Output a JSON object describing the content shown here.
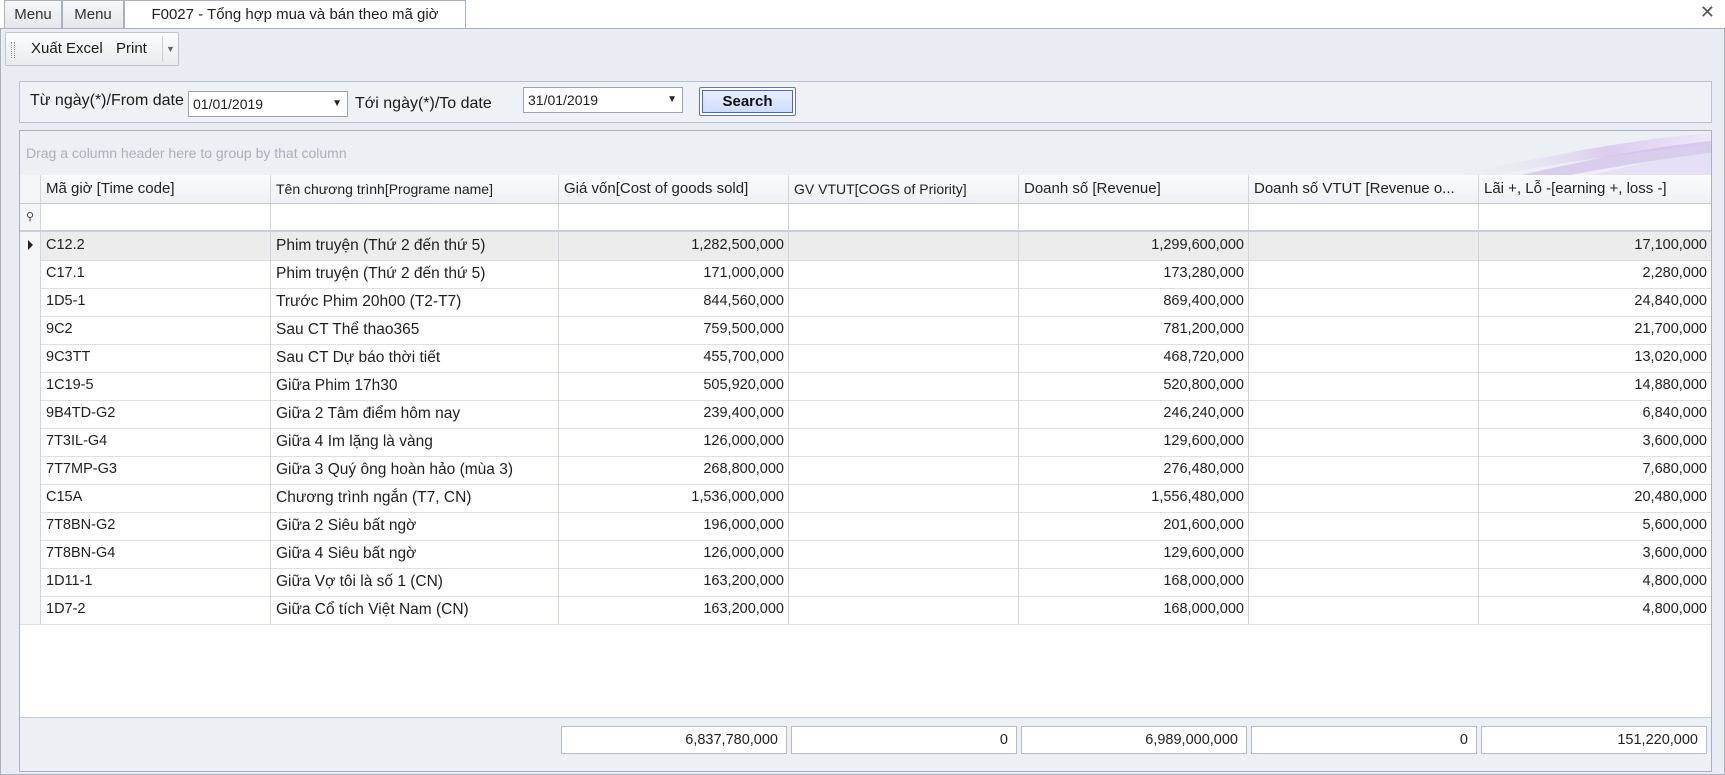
{
  "tabs": [
    {
      "label": "Menu"
    },
    {
      "label": "Menu"
    },
    {
      "label": "F0027 - Tổng hợp mua và bán theo mã giờ"
    }
  ],
  "toolbar": {
    "export_label": "Xuất Excel",
    "print_label": "Print"
  },
  "filter": {
    "from_label": "Từ ngày(*)/From date",
    "from_value": "01/01/2019",
    "to_label": "Tới ngày(*)/To date",
    "to_value": "31/01/2019",
    "search_label": "Search"
  },
  "grid": {
    "group_hint": "Drag a column header here to group by that column",
    "columns": [
      "Mã giờ [Time code]",
      "Tên chương trình[Programe name]",
      "Giá vốn[Cost of goods sold]",
      "GV VTUT[COGS of Priority]",
      "Doanh số [Revenue]",
      "Doanh số VTUT [Revenue o...",
      "Lãi +, Lỗ -[earning +, loss -]"
    ],
    "rows": [
      {
        "code": "C12.2",
        "name": "Phim truyện (Thứ 2 đến thứ 5)",
        "cogs": "1,282,500,000",
        "cogs_p": "",
        "revenue": "1,299,600,000",
        "revenue_p": "",
        "profit": "17,100,000"
      },
      {
        "code": "C17.1",
        "name": "Phim truyện (Thứ 2 đến thứ 5)",
        "cogs": "171,000,000",
        "cogs_p": "",
        "revenue": "173,280,000",
        "revenue_p": "",
        "profit": "2,280,000"
      },
      {
        "code": "1D5-1",
        "name": "Trước Phim 20h00 (T2-T7)",
        "cogs": "844,560,000",
        "cogs_p": "",
        "revenue": "869,400,000",
        "revenue_p": "",
        "profit": "24,840,000"
      },
      {
        "code": "9C2",
        "name": "Sau CT Thể thao365",
        "cogs": "759,500,000",
        "cogs_p": "",
        "revenue": "781,200,000",
        "revenue_p": "",
        "profit": "21,700,000"
      },
      {
        "code": "9C3TT",
        "name": "Sau CT Dự báo thời tiết",
        "cogs": "455,700,000",
        "cogs_p": "",
        "revenue": "468,720,000",
        "revenue_p": "",
        "profit": "13,020,000"
      },
      {
        "code": "1C19-5",
        "name": "Giữa Phim 17h30",
        "cogs": "505,920,000",
        "cogs_p": "",
        "revenue": "520,800,000",
        "revenue_p": "",
        "profit": "14,880,000"
      },
      {
        "code": "9B4TD-G2",
        "name": "Giữa 2 Tâm điểm hôm nay",
        "cogs": "239,400,000",
        "cogs_p": "",
        "revenue": "246,240,000",
        "revenue_p": "",
        "profit": "6,840,000"
      },
      {
        "code": "7T3IL-G4",
        "name": "Giữa 4 Im lặng là vàng",
        "cogs": "126,000,000",
        "cogs_p": "",
        "revenue": "129,600,000",
        "revenue_p": "",
        "profit": "3,600,000"
      },
      {
        "code": "7T7MP-G3",
        "name": "Giữa 3 Quý ông hoàn hảo (mùa 3)",
        "cogs": "268,800,000",
        "cogs_p": "",
        "revenue": "276,480,000",
        "revenue_p": "",
        "profit": "7,680,000"
      },
      {
        "code": "C15A",
        "name": "Chương trình ngắn (T7, CN)",
        "cogs": "1,536,000,000",
        "cogs_p": "",
        "revenue": "1,556,480,000",
        "revenue_p": "",
        "profit": "20,480,000"
      },
      {
        "code": "7T8BN-G2",
        "name": "Giữa 2 Siêu bất ngờ",
        "cogs": "196,000,000",
        "cogs_p": "",
        "revenue": "201,600,000",
        "revenue_p": "",
        "profit": "5,600,000"
      },
      {
        "code": "7T8BN-G4",
        "name": "Giữa 4 Siêu bất ngờ",
        "cogs": "126,000,000",
        "cogs_p": "",
        "revenue": "129,600,000",
        "revenue_p": "",
        "profit": "3,600,000"
      },
      {
        "code": "1D11-1",
        "name": "Giữa Vợ tôi là số 1 (CN)",
        "cogs": "163,200,000",
        "cogs_p": "",
        "revenue": "168,000,000",
        "revenue_p": "",
        "profit": "4,800,000"
      },
      {
        "code": "1D7-2",
        "name": "Giữa Cổ tích Việt Nam (CN)",
        "cogs": "163,200,000",
        "cogs_p": "",
        "revenue": "168,000,000",
        "revenue_p": "",
        "profit": "4,800,000"
      }
    ],
    "totals": {
      "cogs": "6,837,780,000",
      "cogs_p": "0",
      "revenue": "6,989,000,000",
      "revenue_p": "0",
      "profit": "151,220,000"
    }
  },
  "icons": {
    "close": "close-icon",
    "dropdown": "chevron-down-icon",
    "filter_pin": "pin-icon",
    "row_indicator": "row-pointer-icon"
  }
}
